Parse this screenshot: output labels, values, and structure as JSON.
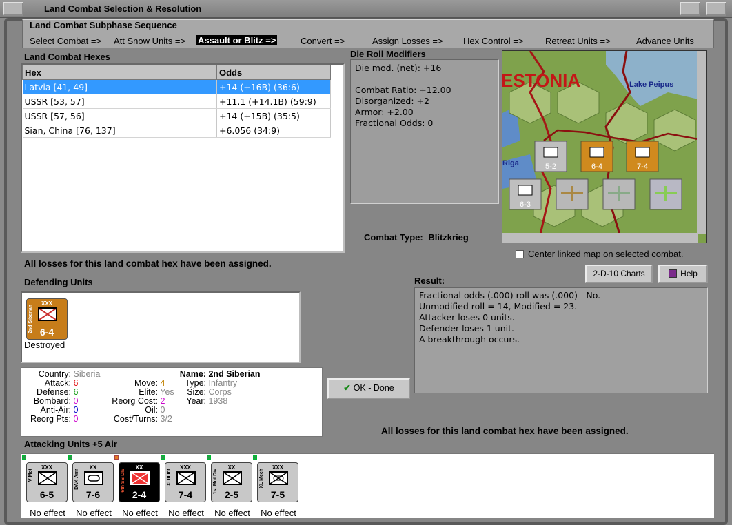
{
  "window": {
    "title": "Land Combat Selection & Resolution"
  },
  "sequence": {
    "heading": "Land Combat Subphase Sequence",
    "steps": [
      "Select Combat =>",
      "Att Snow Units =>",
      "Assault or Blitz =>",
      "Convert =>",
      "Assign Losses =>",
      "Hex Control =>",
      "Retreat Units =>",
      "Advance Units"
    ]
  },
  "hexes": {
    "heading": "Land Combat Hexes",
    "columns": [
      "Hex",
      "Odds"
    ],
    "rows": [
      {
        "hex": "Latvia [41, 49]",
        "odds": "+14 (+16B) (36:6)"
      },
      {
        "hex": "USSR [53, 57]",
        "odds": "+11.1 (+14.1B) (59:9)"
      },
      {
        "hex": "USSR [57, 56]",
        "odds": "+14 (+15B) (35:5)"
      },
      {
        "hex": "Sian, China [76, 137]",
        "odds": "+6.056 (34:9)"
      }
    ]
  },
  "drm": {
    "heading": "Die Roll Modifiers",
    "lines": [
      "Die mod. (net): +16",
      "",
      "Combat Ratio: +12.00",
      "Disorganized: +2",
      "Armor: +2.00",
      "Fractional Odds: 0"
    ]
  },
  "map": {
    "labels": {
      "country": "ESTONIA",
      "lake": "Lake Peipus",
      "city": "Riga"
    },
    "units": [
      {
        "str": "5-2"
      },
      {
        "str": "6-4"
      },
      {
        "str": "7-4"
      },
      {
        "str": "6-3"
      }
    ]
  },
  "combat_type": {
    "label": "Combat Type:",
    "value": "Blitzkrieg"
  },
  "center_map": {
    "label": "Center linked map on selected combat."
  },
  "buttons": {
    "charts": "2-D-10 Charts",
    "help": "Help",
    "ok": "OK - Done"
  },
  "losses_note": "All losses for this land combat hex have been assigned.",
  "defending": {
    "heading": "Defending Units",
    "units": [
      {
        "side": "2nd Siberian",
        "size": "XXX",
        "str": "6-4",
        "status": "Destroyed"
      }
    ]
  },
  "unit_info": {
    "country_label": "Country:",
    "country": "Siberia",
    "attack_label": "Attack:",
    "attack": "6",
    "defense_label": "Defense:",
    "defense": "6",
    "bombard_label": "Bombard:",
    "bombard": "0",
    "antiair_label": "Anti-Air:",
    "antiair": "0",
    "reorgpts_label": "Reorg Pts:",
    "reorgpts": "0",
    "move_label": "Move:",
    "move": "4",
    "elite_label": "Elite:",
    "elite": "Yes",
    "reorgcost_label": "Reorg Cost:",
    "reorgcost": "2",
    "oil_label": "Oil:",
    "oil": "0",
    "costturns_label": "Cost/Turns:",
    "costturns": "3/2",
    "name_label": "Name:",
    "name": "2nd Siberian",
    "type_label": "Type:",
    "type": "Infantry",
    "size_label": "Size:",
    "size": "Corps",
    "year_label": "Year:",
    "year": "1938"
  },
  "result": {
    "heading": "Result:",
    "lines": [
      "Fractional odds (.000) roll was (.000)  - No.",
      "Unmodified roll = 14, Modified = 23.",
      "Attacker loses 0 units.",
      "Defender loses 1 unit.",
      "A breakthrough occurs."
    ]
  },
  "attacking": {
    "heading": "Attacking Units +5 Air",
    "units": [
      {
        "side": "V Mot",
        "size": "XXX",
        "str": "6-5",
        "effect": "No effect"
      },
      {
        "side": "DAK Arm",
        "size": "XX",
        "str": "7-6",
        "effect": "No effect"
      },
      {
        "side": "6th SS Div",
        "size": "XX",
        "str": "2-4",
        "effect": "No effect"
      },
      {
        "side": "XLIII Inf",
        "size": "XXX",
        "str": "7-4",
        "effect": "No effect"
      },
      {
        "side": "1st Mot Div",
        "size": "XX",
        "str": "2-5",
        "effect": "No effect"
      },
      {
        "side": "XL Mech",
        "size": "XXX",
        "str": "7-5",
        "effect": "No effect"
      }
    ]
  },
  "colors": {
    "selection": "#3399ff",
    "attack_value": "#e01010",
    "defense_value": "#119911",
    "bombard_value": "#cc00cc",
    "antiair_value": "#0000cc",
    "reorgpts_value": "#cc00cc",
    "move_value": "#c08000",
    "reorgcost_value": "#cc00cc",
    "defender_counter": "#c77d1a"
  }
}
